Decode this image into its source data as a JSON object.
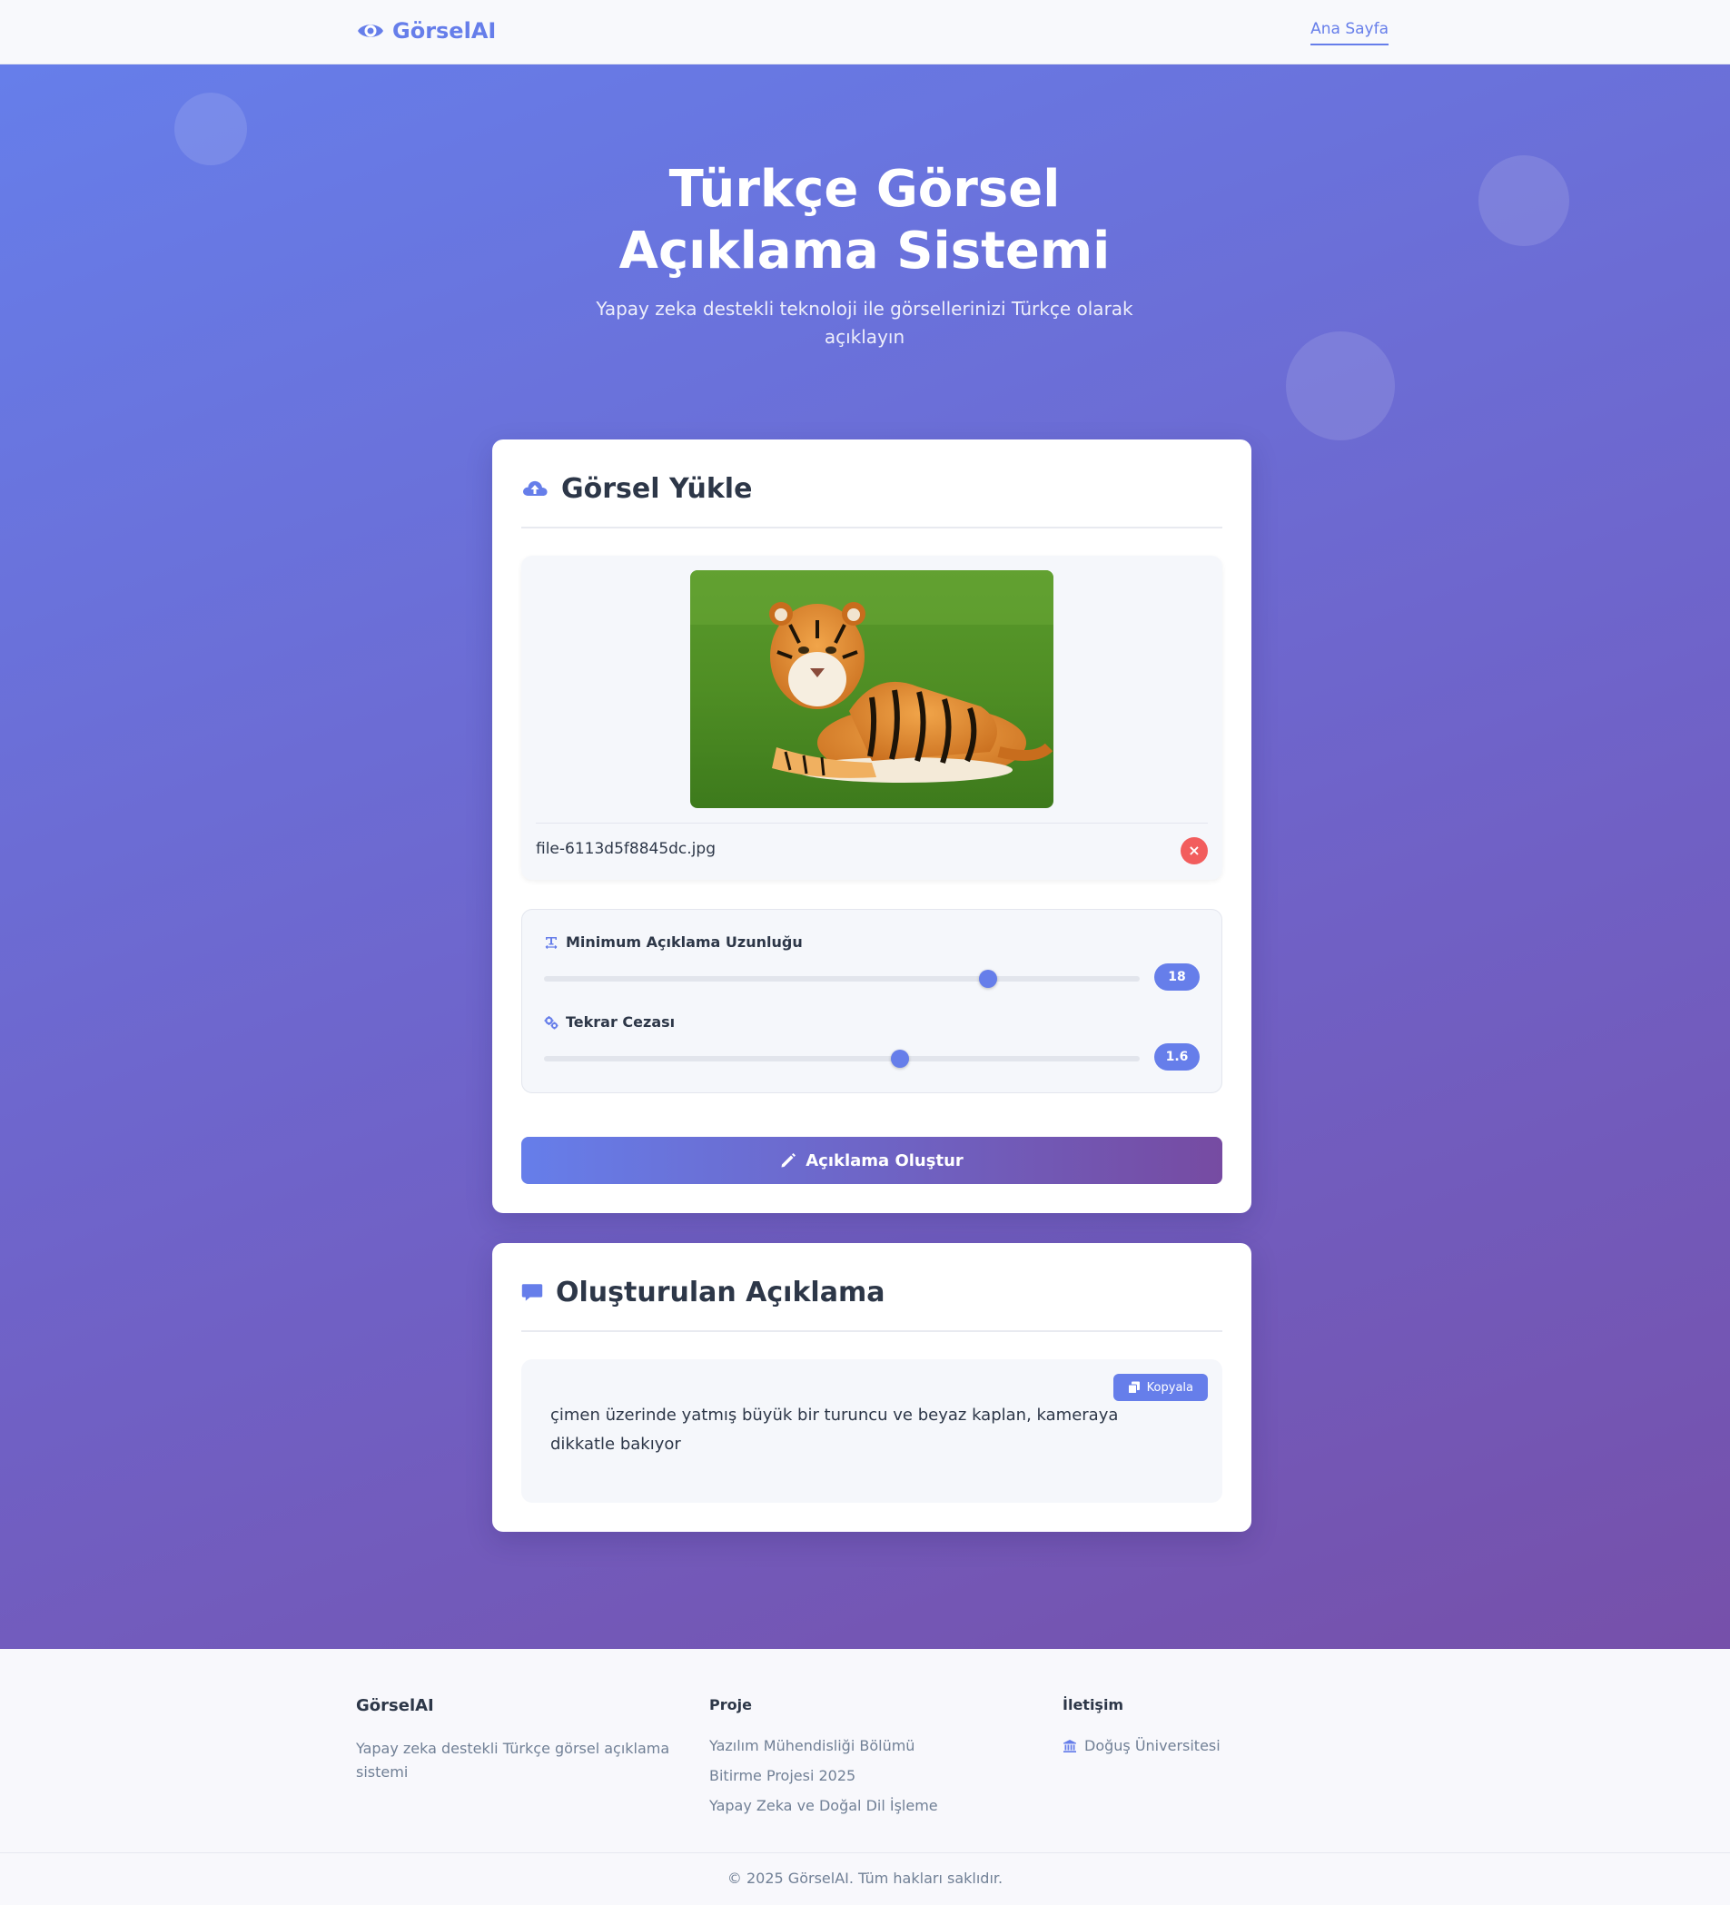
{
  "navbar": {
    "brand": "GörselAI",
    "brand_icon": "eye-icon",
    "links": [
      {
        "label": "Ana Sayfa",
        "active": true
      }
    ]
  },
  "hero": {
    "title": "Türkçe Görsel Açıklama Sistemi",
    "subtitle": "Yapay zeka destekli teknoloji ile görsellerinizi Türkçe olarak açıklayın"
  },
  "upload_card": {
    "title": "Görsel Yükle",
    "icon": "cloud-upload-icon",
    "file_name": "file-6113d5f8845dc.jpg",
    "remove_label": "×",
    "settings": [
      {
        "label": "Minimum Açıklama Uzunluğu",
        "icon": "text-width-icon",
        "value": "18",
        "fill": 0.745
      },
      {
        "label": "Tekrar Cezası",
        "icon": "cogs-icon",
        "value": "1.6",
        "fill": 0.598
      }
    ],
    "generate_label": "Açıklama Oluştur",
    "generate_icon": "pencil-icon"
  },
  "result_card": {
    "title": "Oluşturulan Açıklama",
    "icon": "comment-icon",
    "copy_label": "Kopyala",
    "copy_icon": "copy-icon",
    "text": "çimen üzerinde yatmış büyük bir turuncu ve beyaz kaplan, kameraya dikkatle bakıyor"
  },
  "footer": {
    "col1": {
      "title": "GörselAI",
      "desc": "Yapay zeka destekli Türkçe görsel açıklama sistemi"
    },
    "col2": {
      "title": "Proje",
      "items": [
        "Yazılım Mühendisliği Bölümü",
        "Bitirme Projesi 2025",
        "Yapay Zeka ve Doğal Dil İşleme"
      ]
    },
    "col3": {
      "title": "İletişim",
      "items": [
        {
          "label": "Doğuş Üniversitesi",
          "icon": "university-icon"
        }
      ]
    },
    "copyright": "© 2025 GörselAI. Tüm hakları saklıdır."
  },
  "colors": {
    "accent": "#667eea",
    "accent_end": "#764ba2",
    "danger": "#f25d5d"
  }
}
